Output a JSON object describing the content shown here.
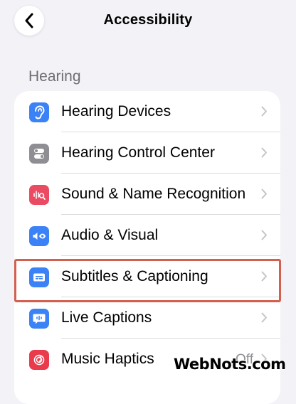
{
  "header": {
    "title": "Accessibility",
    "back_icon": "chevron-left-icon"
  },
  "section": {
    "title": "Hearing"
  },
  "rows": [
    {
      "label": "Hearing Devices",
      "icon": "ear-icon",
      "color": "#3b82f6"
    },
    {
      "label": "Hearing Control Center",
      "icon": "toggles-icon",
      "color": "#8e8e93"
    },
    {
      "label": "Sound & Name Recognition",
      "icon": "waveform-search-icon",
      "color": "#ea4a62"
    },
    {
      "label": "Audio & Visual",
      "icon": "speaker-eye-icon",
      "color": "#3b82f6"
    },
    {
      "label": "Subtitles & Captioning",
      "icon": "subtitles-icon",
      "color": "#3b82f6",
      "highlighted": true
    },
    {
      "label": "Live Captions",
      "icon": "live-captions-icon",
      "color": "#3b82f6"
    },
    {
      "label": "Music Haptics",
      "icon": "music-haptics-icon",
      "color": "#ea3b4c",
      "value": "Off"
    }
  ],
  "highlight_color": "#d2604f",
  "watermark": "WebNots.com"
}
